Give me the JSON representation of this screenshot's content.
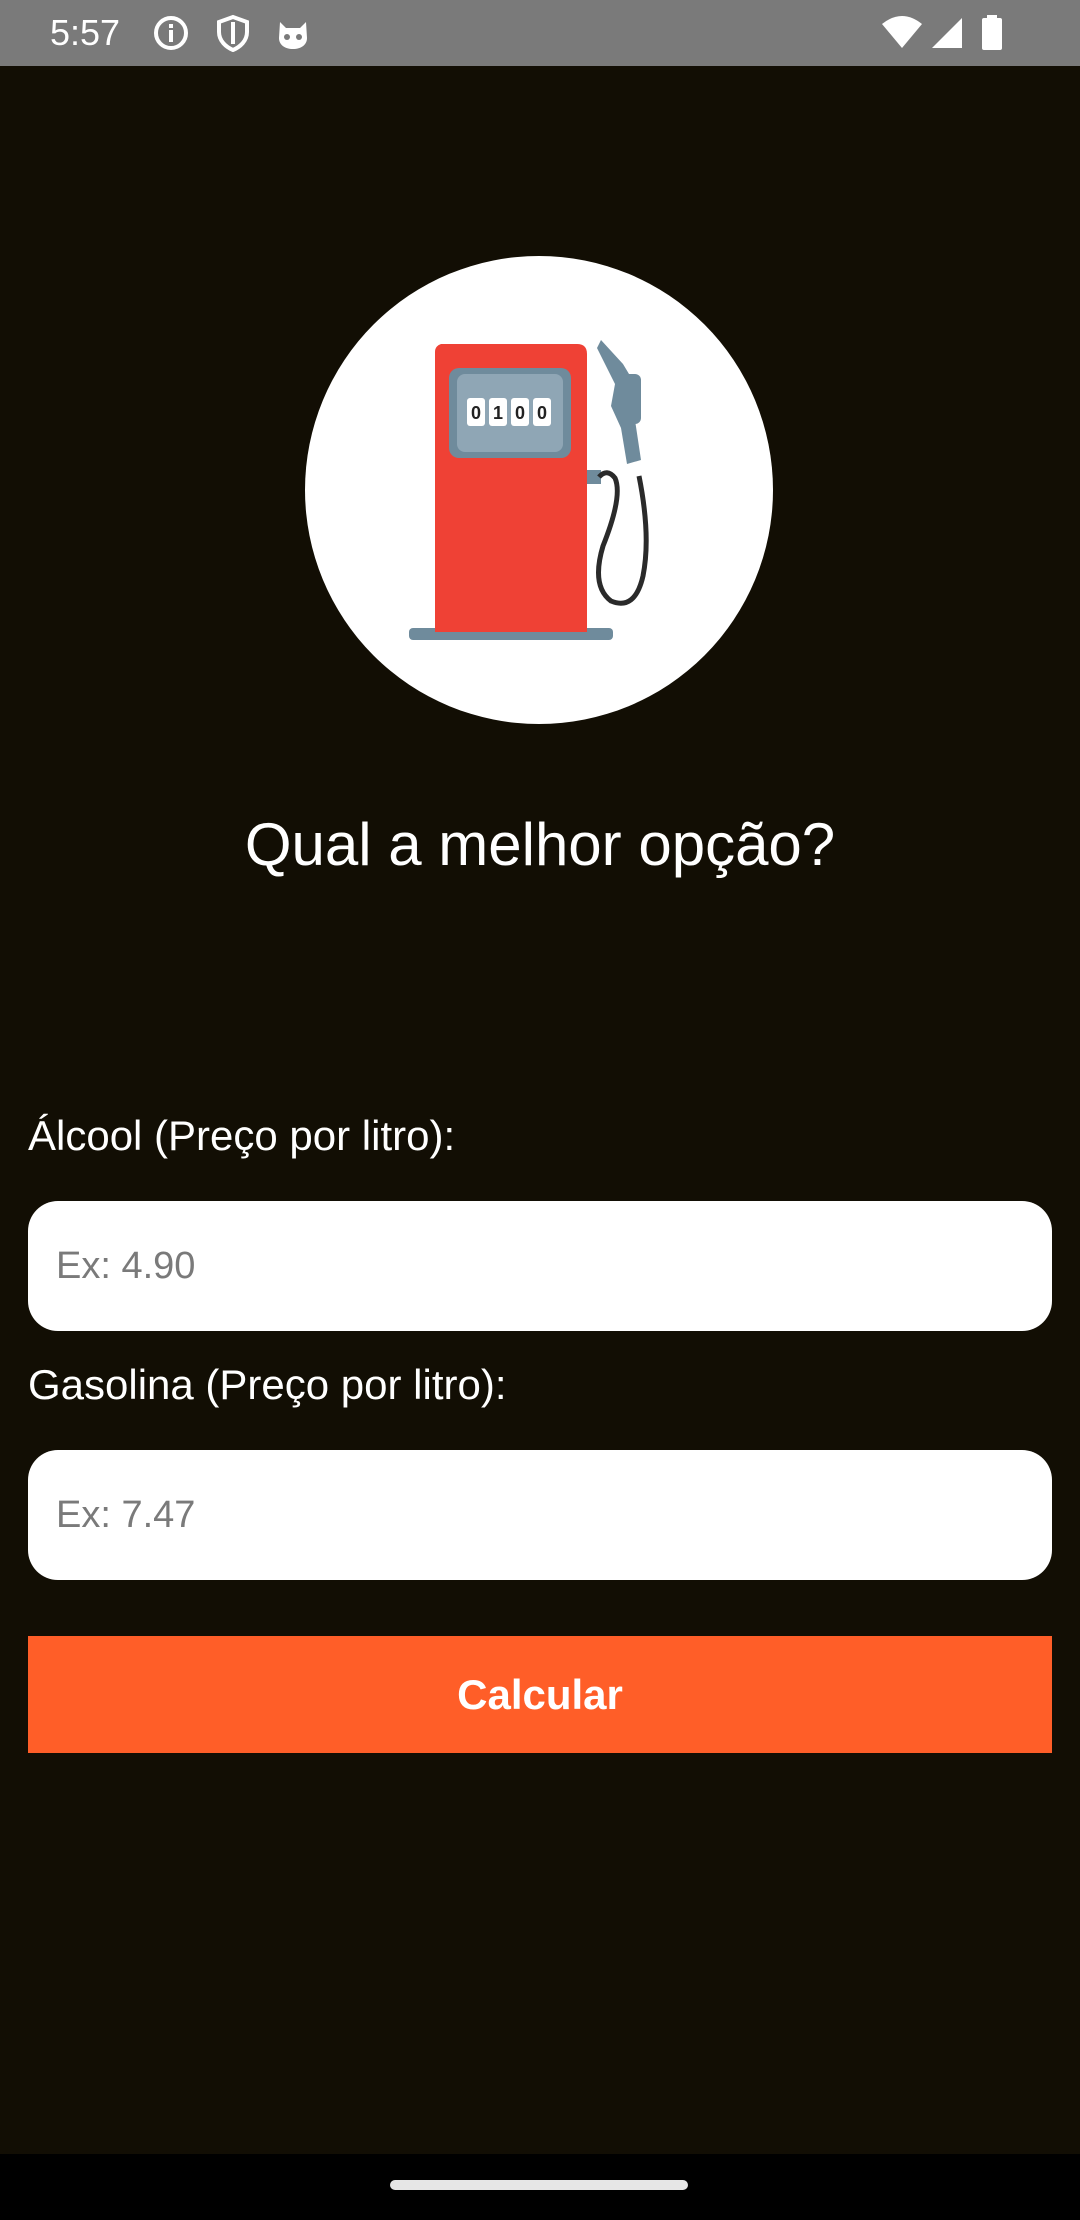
{
  "status_bar": {
    "time": "5:57",
    "left_icons": [
      "info-icon",
      "shield-icon",
      "cat-face-icon"
    ],
    "right_icons": [
      "wifi-icon",
      "cellular-signal-icon",
      "battery-icon"
    ]
  },
  "logo": {
    "icon": "fuel-pump-icon",
    "counter_digits": [
      "0",
      "1",
      "0",
      "0"
    ]
  },
  "main": {
    "question": "Qual a melhor opção?"
  },
  "form": {
    "alcool_label": "Álcool (Preço por litro):",
    "alcool_placeholder": "Ex: 4.90",
    "gasolina_label": "Gasolina (Preço por litro):",
    "gasolina_placeholder": "Ex: 7.47",
    "calc_label": "Calcular"
  },
  "colors": {
    "background": "#120e04",
    "accent": "#ff5e28",
    "pump_red": "#ef4135",
    "pump_gray": "#6f8b9c"
  }
}
